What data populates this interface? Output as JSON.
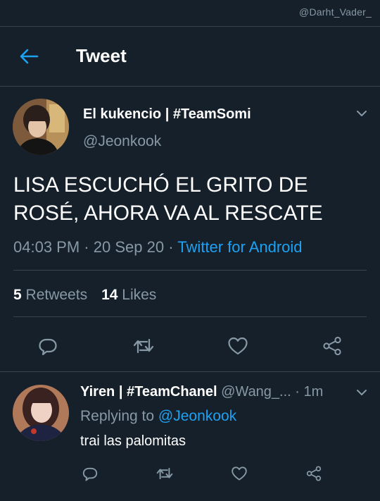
{
  "watermark": "@Darht_Vader_",
  "header": {
    "title": "Tweet",
    "back_icon": "arrow-left-icon"
  },
  "colors": {
    "background": "#15202b",
    "accent": "#1da1f2",
    "secondary_text": "#8899a6",
    "divider": "#38444d"
  },
  "tweet": {
    "author_name": "El kukencio | #TeamSomi",
    "author_handle": "@Jeonkook",
    "text": "LISA ESCUCHÓ EL GRITO DE ROSÉ, AHORA VA AL RESCATE",
    "time": "04:03 PM",
    "date": "20 Sep 20",
    "separator": "·",
    "source": "Twitter for Android",
    "retweets_count": "5",
    "retweets_label": "Retweets",
    "likes_count": "14",
    "likes_label": "Likes",
    "actions": [
      "reply-icon",
      "retweet-icon",
      "like-icon",
      "share-icon"
    ]
  },
  "reply": {
    "author_name": "Yiren | #TeamChanel",
    "author_handle": "@Wang_...",
    "separator": "·",
    "time": "1m",
    "replying_label": "Replying to",
    "replying_to": "@Jeonkook",
    "text": "trai las palomitas",
    "actions": [
      "reply-icon",
      "retweet-icon",
      "like-icon",
      "share-icon"
    ]
  }
}
